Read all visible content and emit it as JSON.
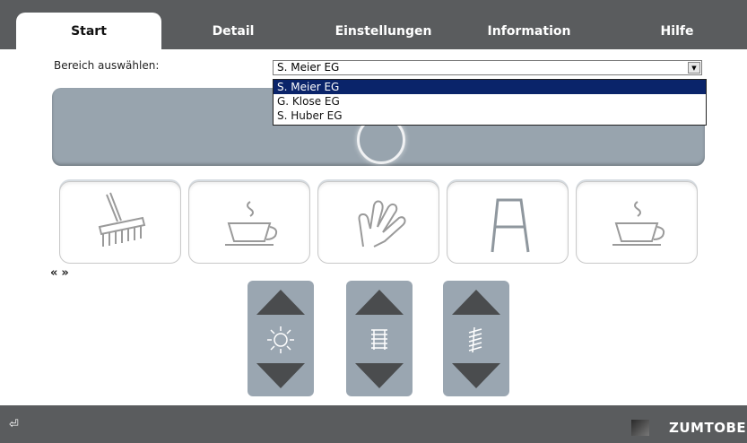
{
  "tabs": [
    {
      "label": "Start"
    },
    {
      "label": "Detail"
    },
    {
      "label": "Einstellungen"
    },
    {
      "label": "Information"
    },
    {
      "label": "Hilfe"
    }
  ],
  "area": {
    "label": "Bereich auswählen:",
    "selected": "S. Meier EG",
    "options": [
      "S. Meier EG",
      "G. Klose EG",
      "S. Huber EG"
    ]
  },
  "scenes": [
    {
      "icon": "broom-icon"
    },
    {
      "icon": "coffee-cup-icon"
    },
    {
      "icon": "hand-wave-icon"
    },
    {
      "icon": "presentation-easel-icon"
    },
    {
      "icon": "coffee-cup-icon"
    }
  ],
  "pager": {
    "prev": "«",
    "next": "»"
  },
  "controls": [
    {
      "name": "light",
      "icon": "sun-icon"
    },
    {
      "name": "blinds",
      "icon": "blinds-icon"
    },
    {
      "name": "slats",
      "icon": "slats-icon"
    }
  ],
  "footer": {
    "brand": "ZUMTOBEL",
    "exit_icon": "exit-icon"
  },
  "colors": {
    "bar": "#5a5c5e",
    "panel": "#98a4ae",
    "selection": "#0a246a"
  }
}
